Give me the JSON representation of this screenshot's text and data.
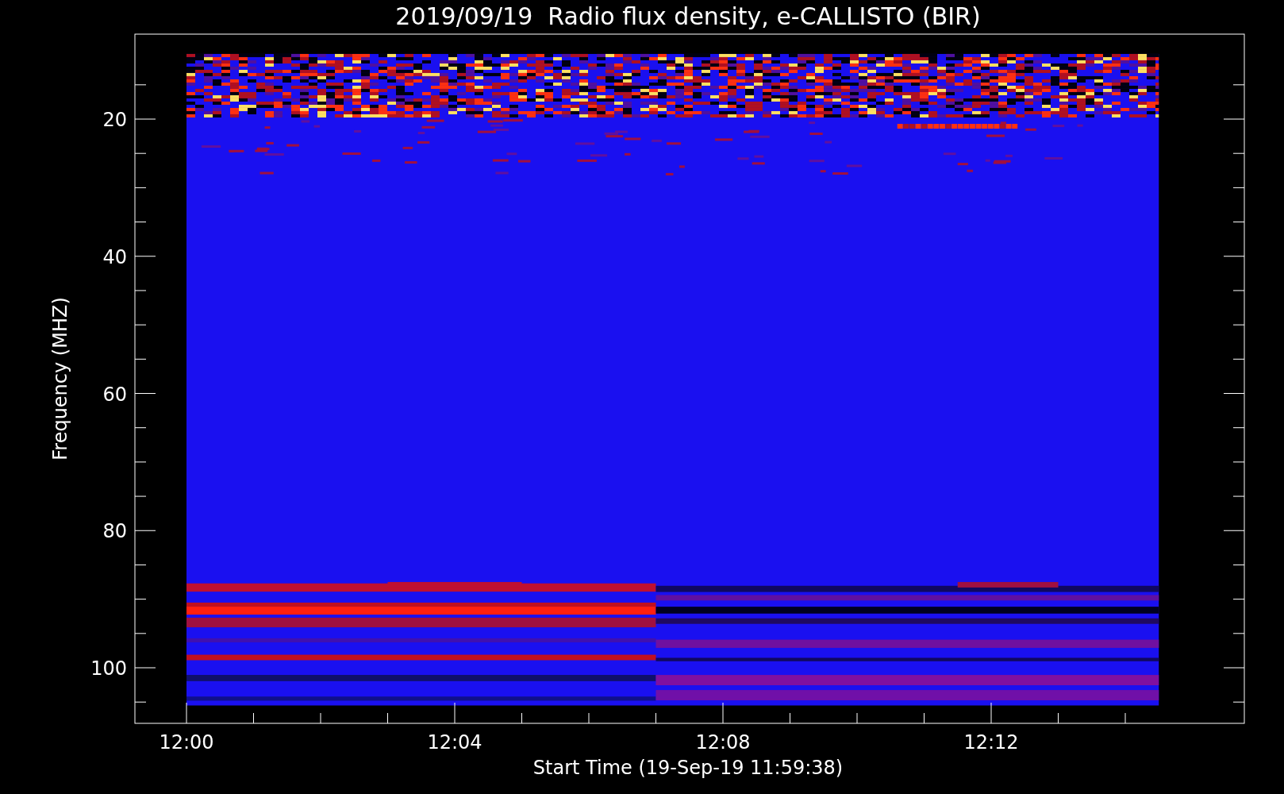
{
  "title": "2019/09/19  Radio flux density, e-CALLISTO (BIR)",
  "y_axis": {
    "label": "Frequency (MHZ)",
    "ticks": [
      "20",
      "40",
      "60",
      "80",
      "100"
    ]
  },
  "x_axis": {
    "label": "Start Time (19-Sep-19 11:59:38)",
    "ticks": [
      "12:00",
      "12:04",
      "12:08",
      "12:12"
    ]
  }
}
